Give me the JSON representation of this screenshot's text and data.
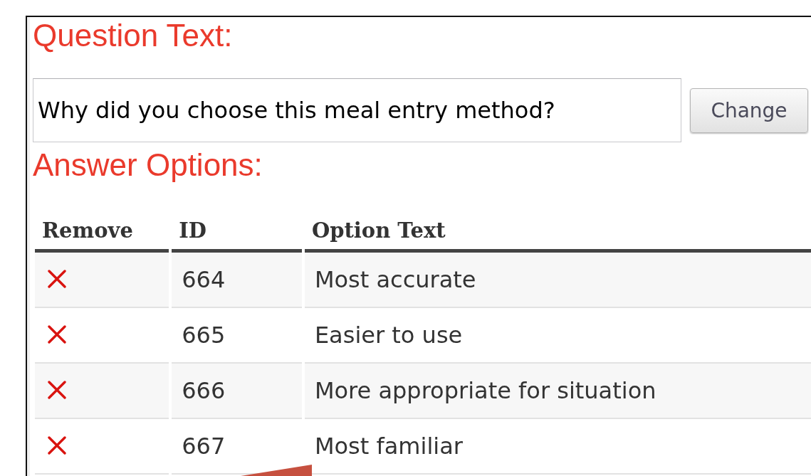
{
  "question": {
    "heading": "Question Text:",
    "value": "Why did you choose this meal entry method?",
    "button": "Change"
  },
  "answers": {
    "heading": "Answer Options:",
    "columns": [
      "Remove",
      "ID",
      "Option Text"
    ],
    "rows": [
      {
        "id": "664",
        "text": "Most accurate"
      },
      {
        "id": "665",
        "text": "Easier to use"
      },
      {
        "id": "666",
        "text": "More appropriate for situation"
      },
      {
        "id": "667",
        "text": "Most familiar"
      }
    ]
  }
}
